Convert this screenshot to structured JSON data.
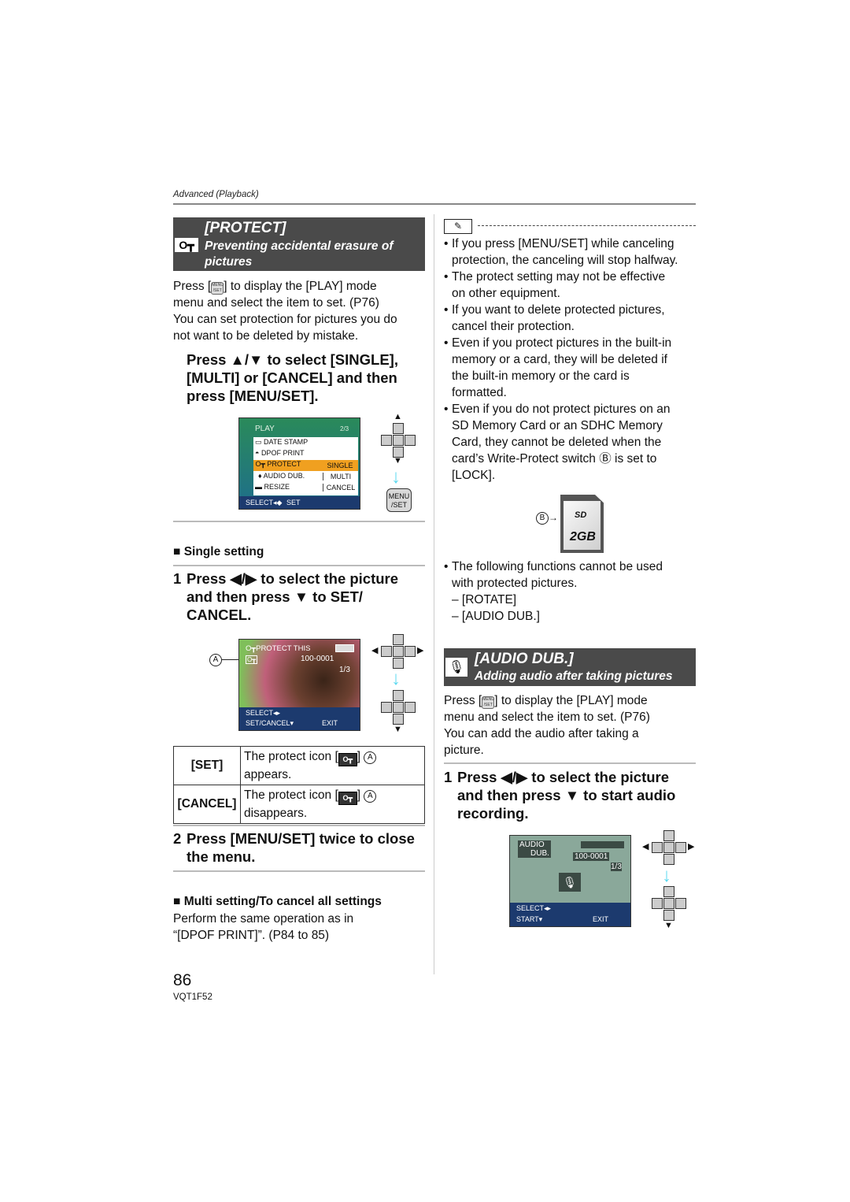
{
  "running_head": "Advanced (Playback)",
  "protect": {
    "title": "[PROTECT]",
    "subtitle_line1": "Preventing accidental erasure of",
    "subtitle_line2": "pictures",
    "icon": "key-icon",
    "intro_press": "Press [",
    "intro_after_btn": "] to display the [PLAY] mode",
    "intro_line2": "menu and select the item to set. (P76)",
    "intro_line3": "You can set protection for pictures you do",
    "intro_line4": "not want to be deleted by mistake.",
    "instruction_line1": "Press ▲/▼ to select [SINGLE],",
    "instruction_line2": "[MULTI] or [CANCEL] and then",
    "instruction_line3": "press [MENU/SET].",
    "menu_screen": {
      "header": "PLAY",
      "page": "2/3",
      "items": [
        "DATE STAMP",
        "DPOF PRINT",
        "PROTECT",
        "AUDIO DUB.",
        "RESIZE"
      ],
      "selected_item": "PROTECT",
      "options": [
        "SINGLE",
        "MULTI",
        "CANCEL"
      ],
      "selected_option": "SINGLE",
      "footer_select": "SELECT◂◆",
      "footer_set": "SET"
    },
    "menu_set_button": {
      "line1": "MENU",
      "line2": "/SET"
    },
    "single_setting_heading": "Single setting",
    "step1": {
      "num": "1",
      "line1": "Press ◀/▶ to select the picture",
      "line2": "and then press ▼ to SET/",
      "line3": "CANCEL."
    },
    "photo_screen": {
      "label_a": "A",
      "title": "PROTECT THIS",
      "file_no": "100-0001",
      "count": "1/3",
      "footer_select": "SELECT◂▸",
      "footer_set": "SET/CANCEL▾",
      "footer_exit": "EXIT"
    },
    "table": [
      {
        "key": "[SET]",
        "pre": "The protect icon [",
        "post": "] ",
        "marker": "A",
        "line2": "appears."
      },
      {
        "key": "[CANCEL]",
        "pre": "The protect icon [",
        "post": "] ",
        "marker": "A",
        "line2": "disappears."
      }
    ],
    "step2": {
      "num": "2",
      "line1": "Press [MENU/SET] twice to close",
      "line2": "the menu."
    },
    "multi_heading": "Multi setting/To cancel all settings",
    "multi_line1": "Perform the same operation as in",
    "multi_line2": "“[DPOF PRINT]”. (P84 to 85)"
  },
  "notes": {
    "icon": "note-book-icon",
    "bullets": [
      [
        "If you press [MENU/SET] while canceling",
        "protection, the canceling will stop halfway."
      ],
      [
        "The protect setting may not be effective",
        "on other equipment."
      ],
      [
        "If you want to delete protected pictures,",
        "cancel their protection."
      ],
      [
        "Even if you protect pictures in the built-in",
        "memory or a card, they will be deleted if",
        "the built-in memory or the card is",
        "formatted."
      ],
      [
        "Even if you do not protect pictures on an",
        "SD Memory Card or an SDHC Memory",
        "Card, they cannot be deleted when the",
        "card’s Write-Protect switch Ⓑ is set to",
        "[LOCK]."
      ]
    ],
    "sd_card": {
      "label_b": "B",
      "logo": "SD",
      "capacity": "2GB"
    },
    "following_line1": "The following functions cannot be used",
    "following_line2": "with protected pictures.",
    "following_items": [
      "– [ROTATE]",
      "– [AUDIO DUB.]"
    ]
  },
  "audio_dub": {
    "title": "[AUDIO DUB.]",
    "subtitle": "Adding audio after taking pictures",
    "icon": "microphone-icon",
    "intro_press": "Press [",
    "intro_after_btn": "] to display the [PLAY] mode",
    "intro_line2": "menu and select the item to set. (P76)",
    "intro_line3": "You can add the audio after taking a",
    "intro_line4": "picture.",
    "step1": {
      "num": "1",
      "line1": "Press ◀/▶ to select the picture",
      "line2": "and then press ▼ to start audio",
      "line3": "recording."
    },
    "screen": {
      "title_line1": "AUDIO",
      "title_line2": "DUB.",
      "file_no": "100-0001",
      "count": "1/3",
      "footer_select": "SELECT◂▸",
      "footer_start": "START▾",
      "footer_exit": "EXIT"
    }
  },
  "page_number": "86",
  "doc_code": "VQT1F52"
}
